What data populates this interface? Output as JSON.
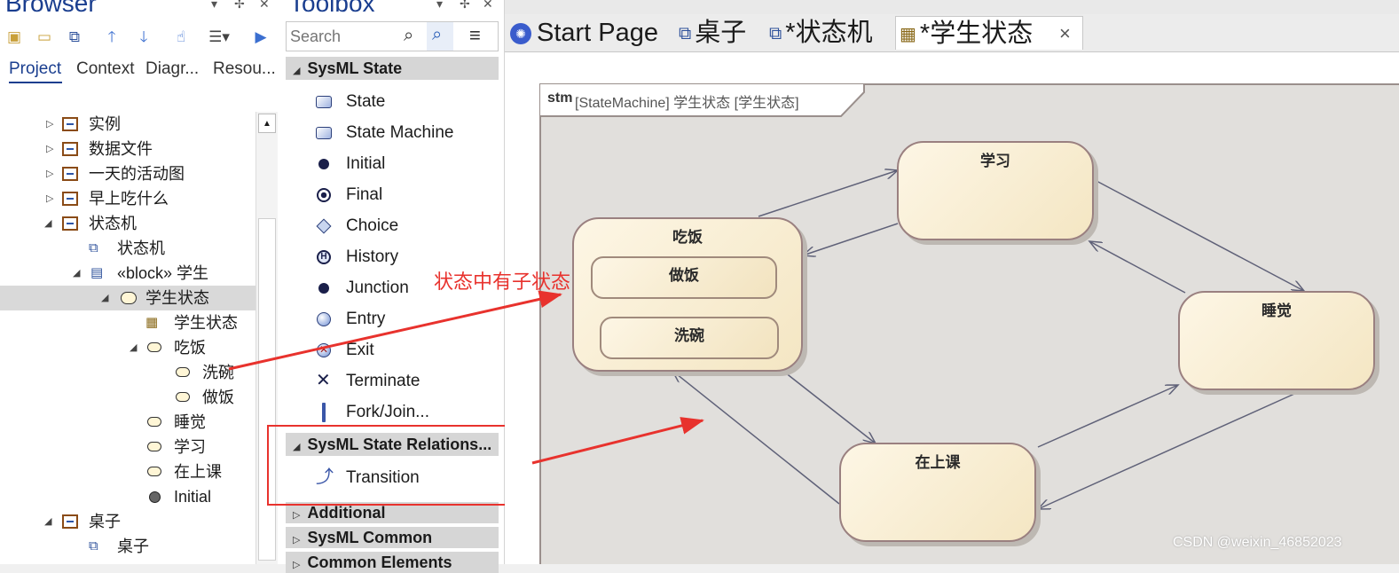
{
  "browser": {
    "title": "Browser",
    "tabs": [
      "Project",
      "Context",
      "Diagr...",
      "Resou..."
    ],
    "tree": [
      {
        "label": "实例"
      },
      {
        "label": "数据文件"
      },
      {
        "label": "一天的活动图"
      },
      {
        "label": "早上吃什么"
      },
      {
        "label": "状态机"
      },
      {
        "label": "状态机"
      },
      {
        "label": "«block» 学生"
      },
      {
        "label": "学生状态"
      },
      {
        "label": "学生状态"
      },
      {
        "label": "吃饭"
      },
      {
        "label": "洗碗"
      },
      {
        "label": "做饭"
      },
      {
        "label": "睡觉"
      },
      {
        "label": "学习"
      },
      {
        "label": "在上课"
      },
      {
        "label": "Initial"
      },
      {
        "label": "桌子"
      },
      {
        "label": "桌子"
      }
    ]
  },
  "toolbox": {
    "title": "Toolbox",
    "search_placeholder": "Search",
    "group_state": "SysML State",
    "state_items": [
      "State",
      "State Machine",
      "Initial",
      "Final",
      "Choice",
      "History",
      "Junction",
      "Entry",
      "Exit",
      "Terminate",
      "Fork/Join..."
    ],
    "group_relations": "SysML State Relations...",
    "relation_items": [
      "Transition"
    ],
    "group_additional": "Additional",
    "group_common": "SysML Common",
    "group_common_elements": "Common Elements"
  },
  "main": {
    "tabs": [
      "Start Page",
      "桌子",
      "*状态机",
      "*学生状态"
    ],
    "close_glyph": "×",
    "diagram_header_kind": "stm",
    "diagram_header_rest": "[StateMachine] 学生状态 [学生状态]",
    "states": {
      "eat": "吃饭",
      "cook": "做饭",
      "wash": "洗碗",
      "study": "学习",
      "sleep": "睡觉",
      "class": "在上课"
    },
    "annotation": "状态中有子状态",
    "watermark": "CSDN @weixin_46852023"
  },
  "colors": {
    "accent_blue": "#1a3e8f",
    "annotation_red": "#e8322d",
    "state_fill": "#f4e6c3",
    "canvas_bg": "#e1dfdc"
  }
}
